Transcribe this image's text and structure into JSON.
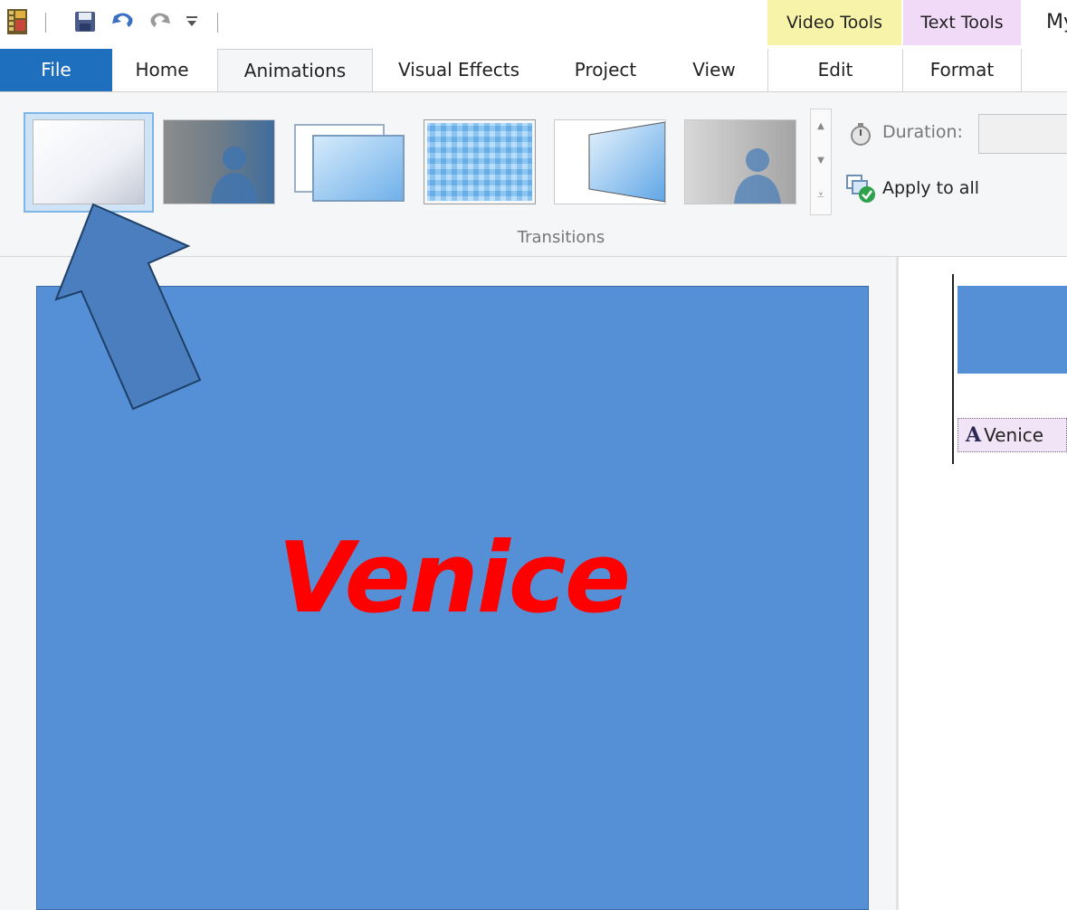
{
  "quick_access": {
    "app_icon": "film-icon",
    "save_icon": "save-icon",
    "undo_icon": "undo-icon",
    "redo_icon": "redo-icon",
    "customize_icon": "dropdown-icon"
  },
  "context_tabs": {
    "video_tools": {
      "label": "Video Tools",
      "color": "#f7f3a8"
    },
    "text_tools": {
      "label": "Text Tools",
      "color": "#f1d9f8"
    }
  },
  "window_title": "My",
  "tabs": [
    {
      "label": "File"
    },
    {
      "label": "Home"
    },
    {
      "label": "Animations"
    },
    {
      "label": "Visual Effects"
    },
    {
      "label": "Project"
    },
    {
      "label": "View"
    },
    {
      "label": "Edit"
    },
    {
      "label": "Format"
    }
  ],
  "active_tab": "Animations",
  "ribbon": {
    "transitions_label": "Transitions",
    "transitions": [
      {
        "name": "none-transition",
        "selected": true
      },
      {
        "name": "cross-fade-transition",
        "selected": false
      },
      {
        "name": "reveal-transition",
        "selected": false
      },
      {
        "name": "pixelate-transition",
        "selected": false
      },
      {
        "name": "flip-transition",
        "selected": false
      },
      {
        "name": "fade-transition",
        "selected": false
      }
    ],
    "duration_label": "Duration:",
    "duration_value": "",
    "apply_all_label": "Apply to all"
  },
  "preview": {
    "title_text": "Venice",
    "background": "#5590d6",
    "text_color": "#ff0000"
  },
  "storyboard": {
    "caption_icon": "A",
    "caption_label": "Venice"
  },
  "annotation": {
    "arrow_color": "#4a7ebf",
    "arrow_target": "none-transition"
  }
}
